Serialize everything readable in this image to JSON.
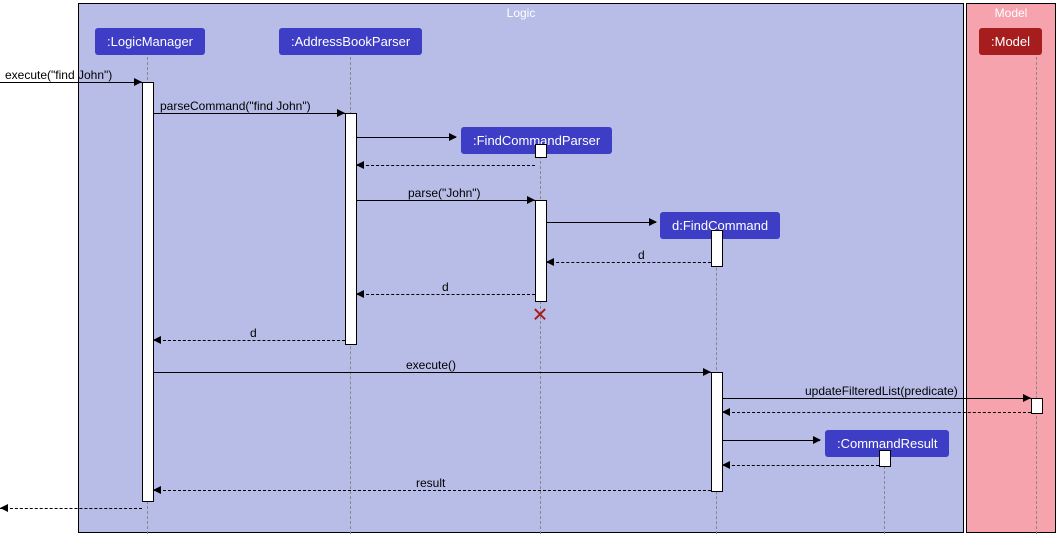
{
  "frames": {
    "logic": {
      "title": "Logic"
    },
    "model": {
      "title": "Model"
    }
  },
  "participants": {
    "logicManager": {
      "label": ":LogicManager"
    },
    "addressBookParser": {
      "label": ":AddressBookParser"
    },
    "findCommandParser": {
      "label": ":FindCommandParser"
    },
    "findCommand": {
      "label": "d:FindCommand"
    },
    "commandResult": {
      "label": ":CommandResult"
    },
    "model": {
      "label": ":Model"
    }
  },
  "messages": {
    "m1": "execute(\"find John\")",
    "m2": "parseCommand(\"find John\")",
    "m3": "parse(\"John\")",
    "m4": "d",
    "m5": "d",
    "m6": "d",
    "m7": "execute()",
    "m8": "updateFilteredList(predicate)",
    "m9": "result"
  }
}
